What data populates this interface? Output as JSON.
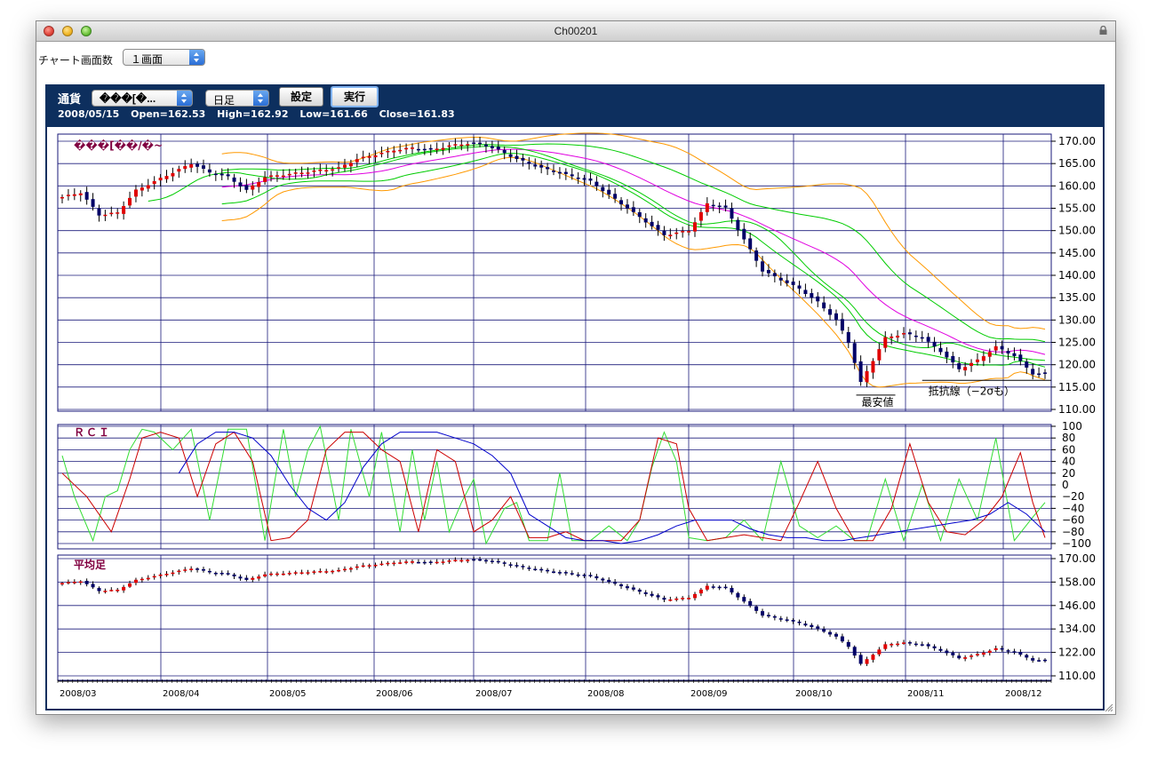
{
  "window": {
    "title": "Ch00201"
  },
  "toolbar": {
    "screen_count_label": "チャート画面数",
    "screen_count_value": "１画面"
  },
  "panel": {
    "title": "通貨",
    "currency_select": "���[�...",
    "period_select": "日足",
    "settings_button": "設定",
    "run_button": "実行",
    "info": {
      "date": "2008/05/15",
      "open": "Open=162.53",
      "high": "High=162.92",
      "low": "Low=161.66",
      "close": "Close=161.83"
    }
  },
  "colors": {
    "panel_bg": "#0d2f5e",
    "grid": "#1a1a7a",
    "bull": "#e00000",
    "bear": "#000066",
    "ma_green": "#00cc00",
    "ma_magenta": "#e000e0",
    "band_orange": "#ff9900",
    "rci_blue": "#0000cc",
    "rci_red": "#cc0000",
    "rci_green": "#33dd33",
    "title_maroon": "#800040"
  },
  "chart_data": [
    {
      "type": "candlestick",
      "title": "���[��/�~",
      "x_ticks": [
        "2008/03",
        "2008/04",
        "2008/05",
        "2008/06",
        "2008/07",
        "2008/08",
        "2008/09",
        "2008/10",
        "2008/11",
        "2008/12"
      ],
      "y_ticks": [
        "170.00",
        "165.00",
        "160.00",
        "155.00",
        "150.00",
        "145.00",
        "140.00",
        "135.00",
        "130.00",
        "125.00",
        "120.00",
        "115.00",
        "110.00"
      ],
      "ylim": [
        110,
        171
      ],
      "annotations": [
        "最安値",
        "抵抗線（−2σも）"
      ],
      "close_trend": [
        [
          0,
          157.5
        ],
        [
          3,
          158.5
        ],
        [
          6,
          153.5
        ],
        [
          9,
          154
        ],
        [
          12,
          159
        ],
        [
          15,
          161
        ],
        [
          18,
          163
        ],
        [
          21,
          165
        ],
        [
          24,
          163
        ],
        [
          27,
          162
        ],
        [
          30,
          159
        ],
        [
          33,
          162
        ],
        [
          36,
          162.5
        ],
        [
          39,
          163
        ],
        [
          42,
          163.5
        ],
        [
          45,
          164
        ],
        [
          48,
          166
        ],
        [
          51,
          167
        ],
        [
          54,
          168
        ],
        [
          57,
          168.5
        ],
        [
          60,
          168
        ],
        [
          63,
          169
        ],
        [
          66,
          169.5
        ],
        [
          68,
          169.5
        ],
        [
          71,
          168
        ],
        [
          74,
          166
        ],
        [
          78,
          164
        ],
        [
          82,
          162.5
        ],
        [
          86,
          161
        ],
        [
          90,
          157
        ],
        [
          94,
          153
        ],
        [
          98,
          149
        ],
        [
          102,
          150
        ],
        [
          105,
          156
        ],
        [
          108,
          155
        ],
        [
          111,
          148
        ],
        [
          114,
          141
        ],
        [
          117,
          139
        ],
        [
          120,
          137
        ],
        [
          123,
          134
        ],
        [
          126,
          130
        ],
        [
          128,
          125
        ],
        [
          130,
          116
        ],
        [
          132,
          121
        ],
        [
          134,
          126
        ],
        [
          137,
          127
        ],
        [
          140,
          126
        ],
        [
          143,
          123
        ],
        [
          146,
          119
        ],
        [
          149,
          121
        ],
        [
          152,
          124
        ],
        [
          155,
          122
        ],
        [
          158,
          118
        ],
        [
          160,
          118
        ]
      ]
    },
    {
      "type": "line",
      "title": "ＲＣＩ",
      "y_ticks": [
        "100",
        "80",
        "60",
        "40",
        "20",
        "0",
        "−20",
        "−40",
        "−60",
        "−80",
        "−100"
      ],
      "ylim": [
        -100,
        100
      ],
      "series": [
        {
          "color": "rci_green",
          "values": [
            [
              0,
              50
            ],
            [
              2,
              -20
            ],
            [
              5,
              -95
            ],
            [
              7,
              -20
            ],
            [
              9,
              -10
            ],
            [
              11,
              60
            ],
            [
              13,
              95
            ],
            [
              15,
              90
            ],
            [
              18,
              60
            ],
            [
              21,
              95
            ],
            [
              24,
              -60
            ],
            [
              27,
              95
            ],
            [
              30,
              95
            ],
            [
              33,
              -95
            ],
            [
              36,
              95
            ],
            [
              38,
              -20
            ],
            [
              40,
              60
            ],
            [
              42,
              100
            ],
            [
              45,
              -60
            ],
            [
              47,
              95
            ],
            [
              50,
              -20
            ],
            [
              52,
              90
            ],
            [
              55,
              -80
            ],
            [
              57,
              60
            ],
            [
              59,
              -60
            ],
            [
              61,
              40
            ],
            [
              63,
              -80
            ],
            [
              65,
              -30
            ],
            [
              67,
              10
            ],
            [
              69,
              -100
            ],
            [
              72,
              -40
            ],
            [
              74,
              -30
            ],
            [
              76,
              -95
            ],
            [
              79,
              -95
            ],
            [
              81,
              20
            ],
            [
              83,
              -95
            ],
            [
              86,
              -95
            ],
            [
              89,
              -70
            ],
            [
              92,
              -95
            ],
            [
              94,
              -60
            ],
            [
              96,
              30
            ],
            [
              98,
              90
            ],
            [
              100,
              40
            ],
            [
              102,
              -90
            ],
            [
              105,
              -95
            ],
            [
              108,
              -90
            ],
            [
              111,
              -60
            ],
            [
              114,
              -95
            ],
            [
              117,
              40
            ],
            [
              120,
              -70
            ],
            [
              123,
              -90
            ],
            [
              126,
              -70
            ],
            [
              129,
              -95
            ],
            [
              131,
              -95
            ],
            [
              134,
              10
            ],
            [
              137,
              -95
            ],
            [
              140,
              0
            ],
            [
              143,
              -95
            ],
            [
              146,
              10
            ],
            [
              149,
              -60
            ],
            [
              152,
              80
            ],
            [
              155,
              -95
            ],
            [
              158,
              -55
            ],
            [
              160,
              -30
            ]
          ]
        },
        {
          "color": "rci_red",
          "values": [
            [
              0,
              20
            ],
            [
              4,
              -20
            ],
            [
              8,
              -80
            ],
            [
              11,
              10
            ],
            [
              13,
              80
            ],
            [
              16,
              90
            ],
            [
              19,
              80
            ],
            [
              22,
              -20
            ],
            [
              25,
              70
            ],
            [
              28,
              90
            ],
            [
              31,
              40
            ],
            [
              34,
              -95
            ],
            [
              37,
              -90
            ],
            [
              40,
              -60
            ],
            [
              43,
              60
            ],
            [
              46,
              90
            ],
            [
              49,
              90
            ],
            [
              52,
              60
            ],
            [
              55,
              40
            ],
            [
              58,
              -80
            ],
            [
              61,
              60
            ],
            [
              64,
              40
            ],
            [
              67,
              -80
            ],
            [
              70,
              -60
            ],
            [
              73,
              -20
            ],
            [
              76,
              -90
            ],
            [
              79,
              -90
            ],
            [
              82,
              -80
            ],
            [
              85,
              -95
            ],
            [
              88,
              -95
            ],
            [
              91,
              -95
            ],
            [
              94,
              -60
            ],
            [
              97,
              80
            ],
            [
              100,
              70
            ],
            [
              102,
              -40
            ],
            [
              105,
              -95
            ],
            [
              108,
              -90
            ],
            [
              111,
              -85
            ],
            [
              114,
              -90
            ],
            [
              117,
              -95
            ],
            [
              120,
              -30
            ],
            [
              123,
              40
            ],
            [
              126,
              -40
            ],
            [
              129,
              -95
            ],
            [
              132,
              -95
            ],
            [
              135,
              -40
            ],
            [
              138,
              70
            ],
            [
              141,
              -30
            ],
            [
              144,
              -80
            ],
            [
              147,
              -85
            ],
            [
              150,
              -60
            ],
            [
              153,
              -20
            ],
            [
              156,
              55
            ],
            [
              158,
              -30
            ],
            [
              160,
              -90
            ]
          ]
        },
        {
          "color": "rci_blue",
          "values": [
            [
              19,
              20
            ],
            [
              22,
              70
            ],
            [
              25,
              90
            ],
            [
              28,
              90
            ],
            [
              31,
              80
            ],
            [
              34,
              50
            ],
            [
              37,
              0
            ],
            [
              40,
              -40
            ],
            [
              43,
              -60
            ],
            [
              46,
              -30
            ],
            [
              49,
              30
            ],
            [
              52,
              70
            ],
            [
              55,
              90
            ],
            [
              58,
              90
            ],
            [
              61,
              90
            ],
            [
              64,
              80
            ],
            [
              67,
              70
            ],
            [
              70,
              50
            ],
            [
              73,
              20
            ],
            [
              76,
              -50
            ],
            [
              79,
              -70
            ],
            [
              82,
              -90
            ],
            [
              85,
              -95
            ],
            [
              88,
              -95
            ],
            [
              91,
              -100
            ],
            [
              94,
              -95
            ],
            [
              97,
              -85
            ],
            [
              100,
              -70
            ],
            [
              103,
              -60
            ],
            [
              106,
              -60
            ],
            [
              109,
              -60
            ],
            [
              112,
              -75
            ],
            [
              115,
              -85
            ],
            [
              118,
              -90
            ],
            [
              121,
              -90
            ],
            [
              124,
              -95
            ],
            [
              127,
              -95
            ],
            [
              130,
              -90
            ],
            [
              133,
              -85
            ],
            [
              136,
              -80
            ],
            [
              139,
              -75
            ],
            [
              142,
              -70
            ],
            [
              145,
              -65
            ],
            [
              148,
              -60
            ],
            [
              151,
              -50
            ],
            [
              154,
              -30
            ],
            [
              157,
              -50
            ],
            [
              160,
              -80
            ]
          ]
        }
      ]
    },
    {
      "type": "candlestick",
      "title": "平均足",
      "y_ticks": [
        "170.00",
        "158.00",
        "146.00",
        "134.00",
        "122.00",
        "110.00"
      ],
      "ylim": [
        110,
        171
      ]
    }
  ]
}
